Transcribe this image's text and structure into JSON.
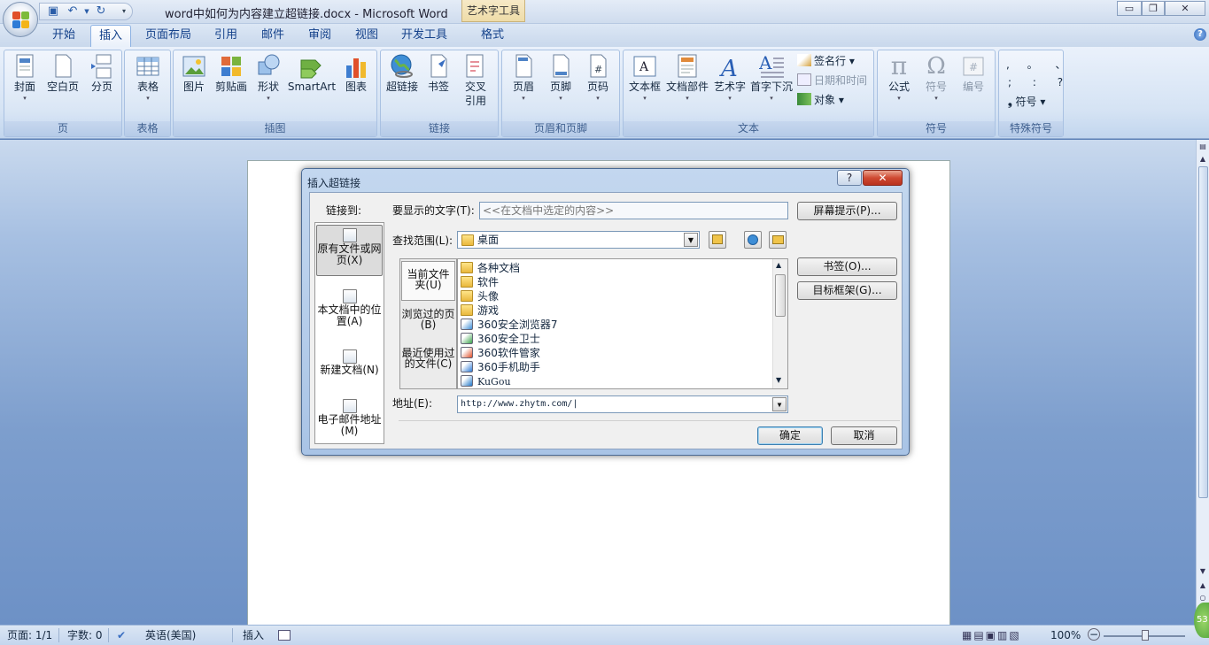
{
  "window": {
    "title": "word中如何为内容建立超链接.docx - Microsoft Word",
    "contextual_tab": "艺术字工具",
    "minimize": "▭",
    "restore": "❐",
    "close": "✕"
  },
  "ribbon": {
    "tabs": [
      {
        "label": "开始",
        "active": false
      },
      {
        "label": "插入",
        "active": true
      },
      {
        "label": "页面布局",
        "active": false
      },
      {
        "label": "引用",
        "active": false
      },
      {
        "label": "邮件",
        "active": false
      },
      {
        "label": "审阅",
        "active": false
      },
      {
        "label": "视图",
        "active": false
      },
      {
        "label": "开发工具",
        "active": false
      },
      {
        "label": "格式",
        "active": false
      }
    ],
    "groups": {
      "page": {
        "label": "页",
        "cover": "封面",
        "blank": "空白页",
        "break": "分页"
      },
      "table": {
        "label": "表格",
        "table": "表格"
      },
      "illustrations": {
        "label": "插图",
        "picture": "图片",
        "clipart": "剪贴画",
        "shapes": "形状",
        "smartart": "SmartArt",
        "chart": "图表"
      },
      "links": {
        "label": "链接",
        "hyperlink": "超链接",
        "bookmark": "书签",
        "crossref_1": "交叉",
        "crossref_2": "引用"
      },
      "header_footer": {
        "label": "页眉和页脚",
        "header": "页眉",
        "footer": "页脚",
        "page_number": "页码"
      },
      "text": {
        "label": "文本",
        "textbox": "文本框",
        "quickparts": "文档部件",
        "wordart": "艺术字",
        "dropcap": "首字下沉",
        "signature": "签名行",
        "datetime": "日期和时间",
        "object": "对象"
      },
      "symbols": {
        "label": "符号",
        "equation": "公式",
        "symbol": "符号",
        "number": "编号"
      },
      "special": {
        "label": "特殊符号",
        "row1": ", 。 、",
        "row2": "; : ?",
        "symbol": "符号"
      }
    }
  },
  "dialog": {
    "title": "插入超链接",
    "help": "?",
    "close": "✕",
    "link_to_label": "链接到:",
    "link_to": [
      {
        "label": "原有文件或网页(X)",
        "selected": true
      },
      {
        "label": "本文档中的位置(A)",
        "selected": false
      },
      {
        "label": "新建文档(N)",
        "selected": false
      },
      {
        "label": "电子邮件地址(M)",
        "selected": false
      }
    ],
    "display_text_label": "要显示的文字(T):",
    "display_text_value": "<<在文档中选定的内容>>",
    "screentip_button": "屏幕提示(P)...",
    "look_in_label": "查找范围(L):",
    "look_in_value": "桌面",
    "subnav": [
      {
        "label": "当前文件夹(U)",
        "selected": true
      },
      {
        "label": "浏览过的页(B)",
        "selected": false
      },
      {
        "label": "最近使用过的文件(C)",
        "selected": false
      }
    ],
    "files": [
      {
        "name": "各种文档",
        "icon": "folder-icon"
      },
      {
        "name": "软件",
        "icon": "folder-icon"
      },
      {
        "name": "头像",
        "icon": "folder-icon"
      },
      {
        "name": "游戏",
        "icon": "folder-icon"
      },
      {
        "name": "360安全浏览器7",
        "icon": "shortcut-browser-icon"
      },
      {
        "name": "360安全卫士",
        "icon": "shortcut-shield-icon"
      },
      {
        "name": "360软件管家",
        "icon": "shortcut-box-icon"
      },
      {
        "name": "360手机助手",
        "icon": "shortcut-phone-icon"
      },
      {
        "name": "KuGou",
        "icon": "shortcut-music-icon"
      }
    ],
    "bookmark_button": "书签(O)...",
    "target_frame_button": "目标框架(G)...",
    "address_label": "地址(E):",
    "address_value": "http://www.zhytm.com/",
    "ok_button": "确定",
    "cancel_button": "取消"
  },
  "status": {
    "page": "页面: 1/1",
    "words": "字数: 0",
    "language": "英语(美国)",
    "mode": "插入",
    "zoom": "100%",
    "badge": "53"
  }
}
